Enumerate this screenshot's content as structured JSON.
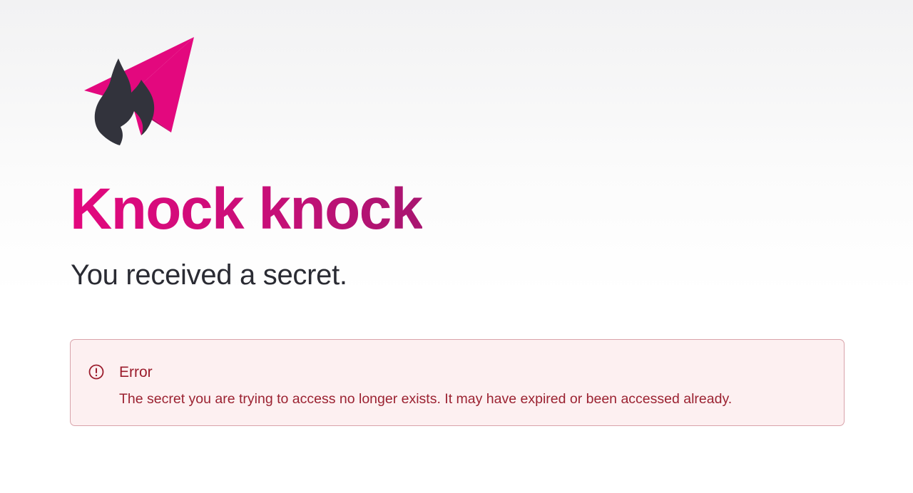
{
  "logo": {
    "icon": "flame-paper-plane-logo-icon",
    "colors": {
      "plane": "#e3087e",
      "flame": "#32333c"
    }
  },
  "hero": {
    "title": "Knock knock",
    "subtitle": "You received a secret."
  },
  "alert": {
    "icon": "exclamation-circle-icon",
    "title": "Error",
    "message": "The secret you are trying to access no longer exists. It may have expired or been accessed already.",
    "colors": {
      "text": "#9b1c2c",
      "border": "#d9a3aa",
      "background": "#fdf0f1"
    }
  },
  "colors": {
    "accent": "#e3087e",
    "text": "#2a2b33"
  }
}
